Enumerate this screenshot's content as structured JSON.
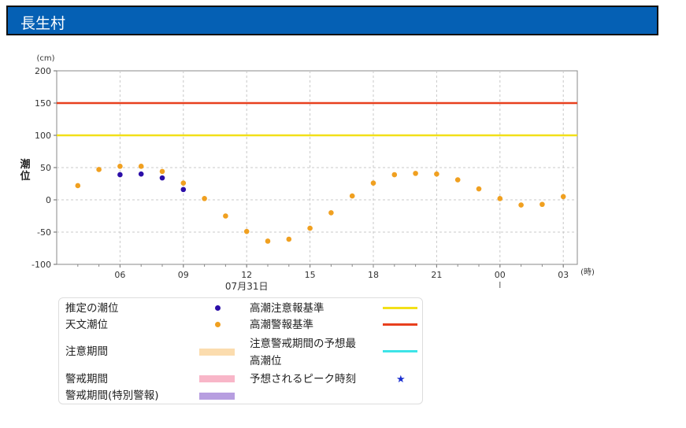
{
  "header": {
    "title": "長生村"
  },
  "chart_data": {
    "type": "scatter",
    "y_unit": "(cm)",
    "ylabel": "潮位",
    "x_unit": "(時)",
    "date_label": "07月31日",
    "ylim": [
      -100,
      200
    ],
    "y_ticks": [
      "200",
      "150",
      "100",
      "50",
      "0",
      "-50",
      "-100"
    ],
    "x_ticks": [
      "06",
      "09",
      "12",
      "15",
      "18",
      "21",
      "00",
      "03"
    ],
    "grid": true,
    "series": [
      {
        "name": "推定の潮位",
        "color": "#2b0ea8",
        "x": [
          "05:00",
          "06:00",
          "07:00",
          "08:00"
        ],
        "values": [
          39,
          40,
          34,
          16
        ]
      },
      {
        "name": "天文潮位",
        "color": "#f0a020",
        "x": [
          "04:00",
          "05:00",
          "06:00",
          "07:00",
          "08:00",
          "09:00",
          "10:00",
          "11:00",
          "12:00",
          "13:00",
          "14:00",
          "15:00",
          "16:00",
          "17:00",
          "18:00",
          "19:00",
          "20:00",
          "21:00",
          "22:00",
          "23:00",
          "00:00",
          "01:00",
          "02:00",
          "03:00"
        ],
        "values": [
          47,
          52,
          52,
          44,
          26,
          2,
          -25,
          -49,
          -64,
          -61,
          -44,
          -20,
          6,
          26,
          39,
          41,
          40,
          31,
          17,
          2,
          -8,
          -7,
          5,
          22
        ]
      }
    ],
    "thresholds": [
      {
        "name": "高潮注意報基準",
        "value": 100,
        "color": "#f2e018"
      },
      {
        "name": "高潮警報基準",
        "value": 150,
        "color": "#e8401e"
      }
    ]
  },
  "legend": {
    "estimated": "推定の潮位",
    "astronomical": "天文潮位",
    "caution_period": "注意期間",
    "warning_period": "警戒期間",
    "special_warning_period": "警戒期間(特別警報)",
    "advisory_standard": "高潮注意報基準",
    "warning_standard": "高潮警報基準",
    "forecast_max_line1": "注意警戒期間の予想最",
    "forecast_max_line2": "高潮位",
    "peak_time": "予想されるピーク時刻",
    "colors": {
      "caution": "#fbdcae",
      "warning": "#f8b6c8",
      "special": "#b79ee0",
      "forecast_max": "#3de4e8",
      "star": "#1a2ed0"
    }
  }
}
